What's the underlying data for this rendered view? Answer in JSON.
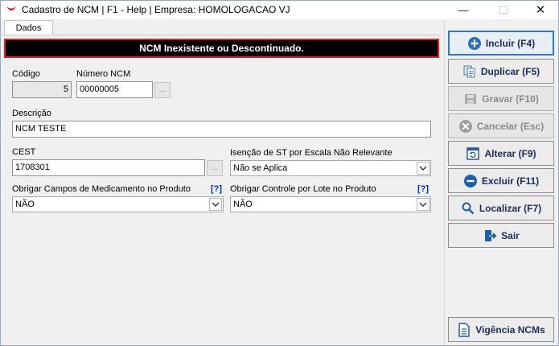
{
  "window": {
    "title": "Cadastro de NCM | F1 - Help | Empresa: HOMOLOGACAO VJ",
    "controls": {
      "minimize": "—",
      "maximize": "☐",
      "close": "✕"
    }
  },
  "tabs": [
    {
      "label": "Dados",
      "active": true
    }
  ],
  "alert": {
    "message": "NCM Inexistente ou Descontinuado.",
    "color": "#000000",
    "border": "#e02020"
  },
  "form": {
    "codigo": {
      "label": "Código",
      "value": "5"
    },
    "numero_ncm": {
      "label": "Número NCM",
      "value": "00000005",
      "lookup": "..."
    },
    "descricao": {
      "label": "Descrição",
      "value": "NCM TESTE"
    },
    "cest": {
      "label": "CEST",
      "value": "1708301",
      "lookup": "..."
    },
    "isencao_st": {
      "label": "Isenção de ST por Escala Não Relevante",
      "value": "Não se Aplica"
    },
    "obrigar_medicamento": {
      "label": "Obrigar Campos de Medicamento no Produto",
      "value": "NÃO",
      "help": "[?]"
    },
    "obrigar_lote": {
      "label": "Obrigar Controle por Lote no Produto",
      "value": "NÃO",
      "help": "[?]"
    }
  },
  "actions": {
    "incluir": {
      "label": "Incluir (F4)",
      "icon": "plus-circle-icon",
      "color": "#2a6fc0"
    },
    "duplicar": {
      "label": "Duplicar (F5)",
      "icon": "copy-icon"
    },
    "gravar": {
      "label": "Gravar (F10)",
      "icon": "save-icon",
      "disabled": true
    },
    "cancelar": {
      "label": "Cancelar (Esc)",
      "icon": "x-circle-icon",
      "disabled": true
    },
    "alterar": {
      "label": "Alterar (F9)",
      "icon": "edit-window-icon"
    },
    "excluir": {
      "label": "Excluir (F11)",
      "icon": "minus-circle-icon"
    },
    "localizar": {
      "label": "Localizar (F7)",
      "icon": "search-icon"
    },
    "sair": {
      "label": "Sair",
      "icon": "exit-door-icon"
    },
    "vigencia": {
      "label": "Vigência NCMs",
      "icon": "document-icon"
    }
  }
}
